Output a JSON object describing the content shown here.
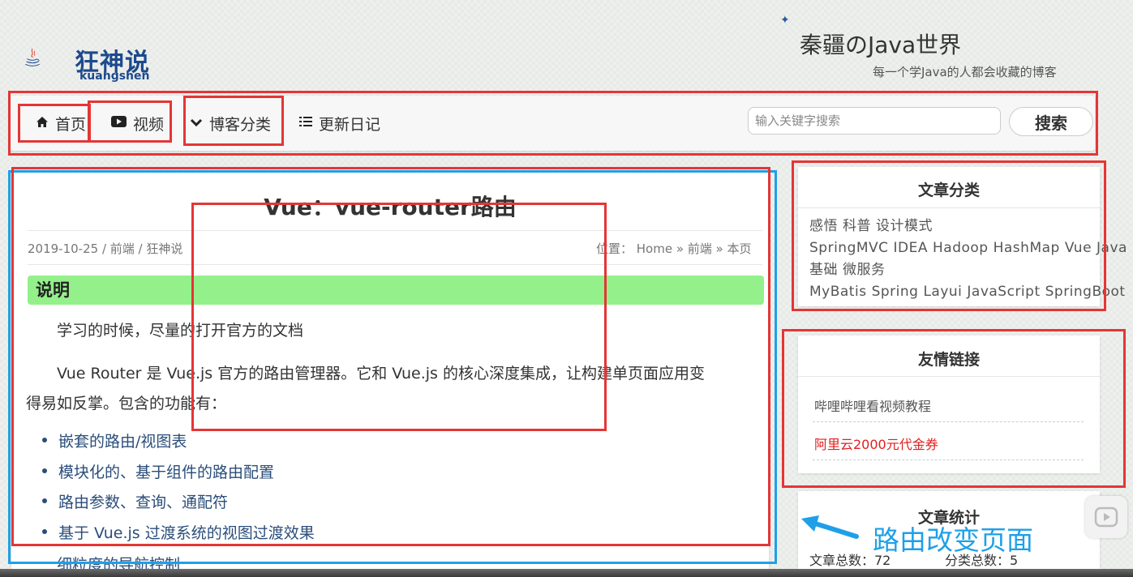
{
  "header": {
    "logo_cn": "狂神说",
    "logo_en": "kuangshen",
    "site_title": "秦疆のJava世界",
    "site_subtitle": "每一个学Java的人都会收藏的博客"
  },
  "nav": {
    "items": [
      {
        "label": "首页",
        "icon": "home-icon"
      },
      {
        "label": "视频",
        "icon": "youtube-play-icon"
      },
      {
        "label": "博客分类",
        "icon": "chevron-down-icon"
      },
      {
        "label": "更新日记",
        "icon": "list-icon"
      }
    ],
    "search_placeholder": "输入关键字搜索",
    "search_button": "搜索"
  },
  "article": {
    "title": "Vue：vue-router路由",
    "meta_left": "2019-10-25 / 前端 / 狂神说",
    "meta_right": "位置： Home » 前端 » 本页",
    "section_heading": "说明",
    "para1": "学习的时候，尽量的打开官方的文档",
    "para2_line1": "Vue Router 是 Vue.js 官方的路由管理器。它和 Vue.js 的核心深度集成，让构建单页面应用变",
    "para2_line2": "得易如反掌。包含的功能有：",
    "features": [
      "嵌套的路由/视图表",
      "模块化的、基于组件的路由配置",
      "路由参数、查询、通配符",
      "基于 Vue.js 过渡系统的视图过渡效果"
    ],
    "cutoff_feature": "细粒度的导航控制"
  },
  "sidebar": {
    "categories_title": "文章分类",
    "tags": [
      "感悟",
      "科普",
      "设计模式",
      "SpringMVC",
      "IDEA",
      "Hadoop",
      "HashMap",
      "Vue",
      "Java基础",
      "微服务",
      "MyBatis",
      "Spring",
      "Layui",
      "JavaScript",
      "SpringBoot"
    ],
    "links_title": "友情链接",
    "links": [
      "哔哩哔哩看视频教程",
      "阿里云2000元代金券"
    ],
    "stats_title": "文章统计",
    "stats_articles": "文章总数：72",
    "stats_categories": "分类总数：5"
  },
  "annotation": {
    "text": "路由改变页面"
  },
  "colors": {
    "annotation_red": "#e53535",
    "annotation_blue": "#1ea0e8",
    "section_green": "#94f08a",
    "link_red": "#e02020"
  }
}
